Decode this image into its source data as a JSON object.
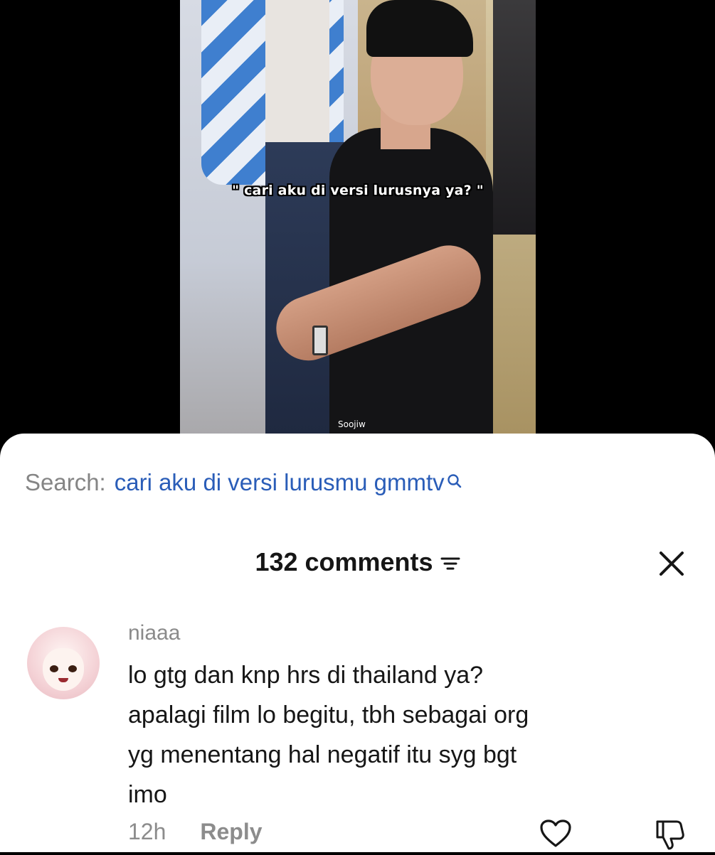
{
  "video": {
    "caption": "\" cari aku di versi lurusnya ya? \"",
    "watermark": "Soojiw"
  },
  "search": {
    "label": "Search:",
    "query": "cari aku di versi lurusmu gmmtv"
  },
  "comments_header": {
    "title": "132 comments"
  },
  "comment": {
    "author": "niaaa",
    "lines": [
      "lo gtg dan knp hrs di thailand ya?",
      "apalagi film lo begitu, tbh sebagai org",
      "yg menentang hal negatif itu syg bgt",
      "imo"
    ],
    "time": "12h",
    "reply_label": "Reply"
  },
  "icons": {
    "search": "search-icon",
    "filter": "filter-icon",
    "close": "close-icon",
    "like": "heart-icon",
    "dislike": "thumbs-down-icon"
  },
  "colors": {
    "link_blue": "#2a5db8",
    "muted_gray": "#8c8c8c",
    "text_dark": "#161616"
  }
}
